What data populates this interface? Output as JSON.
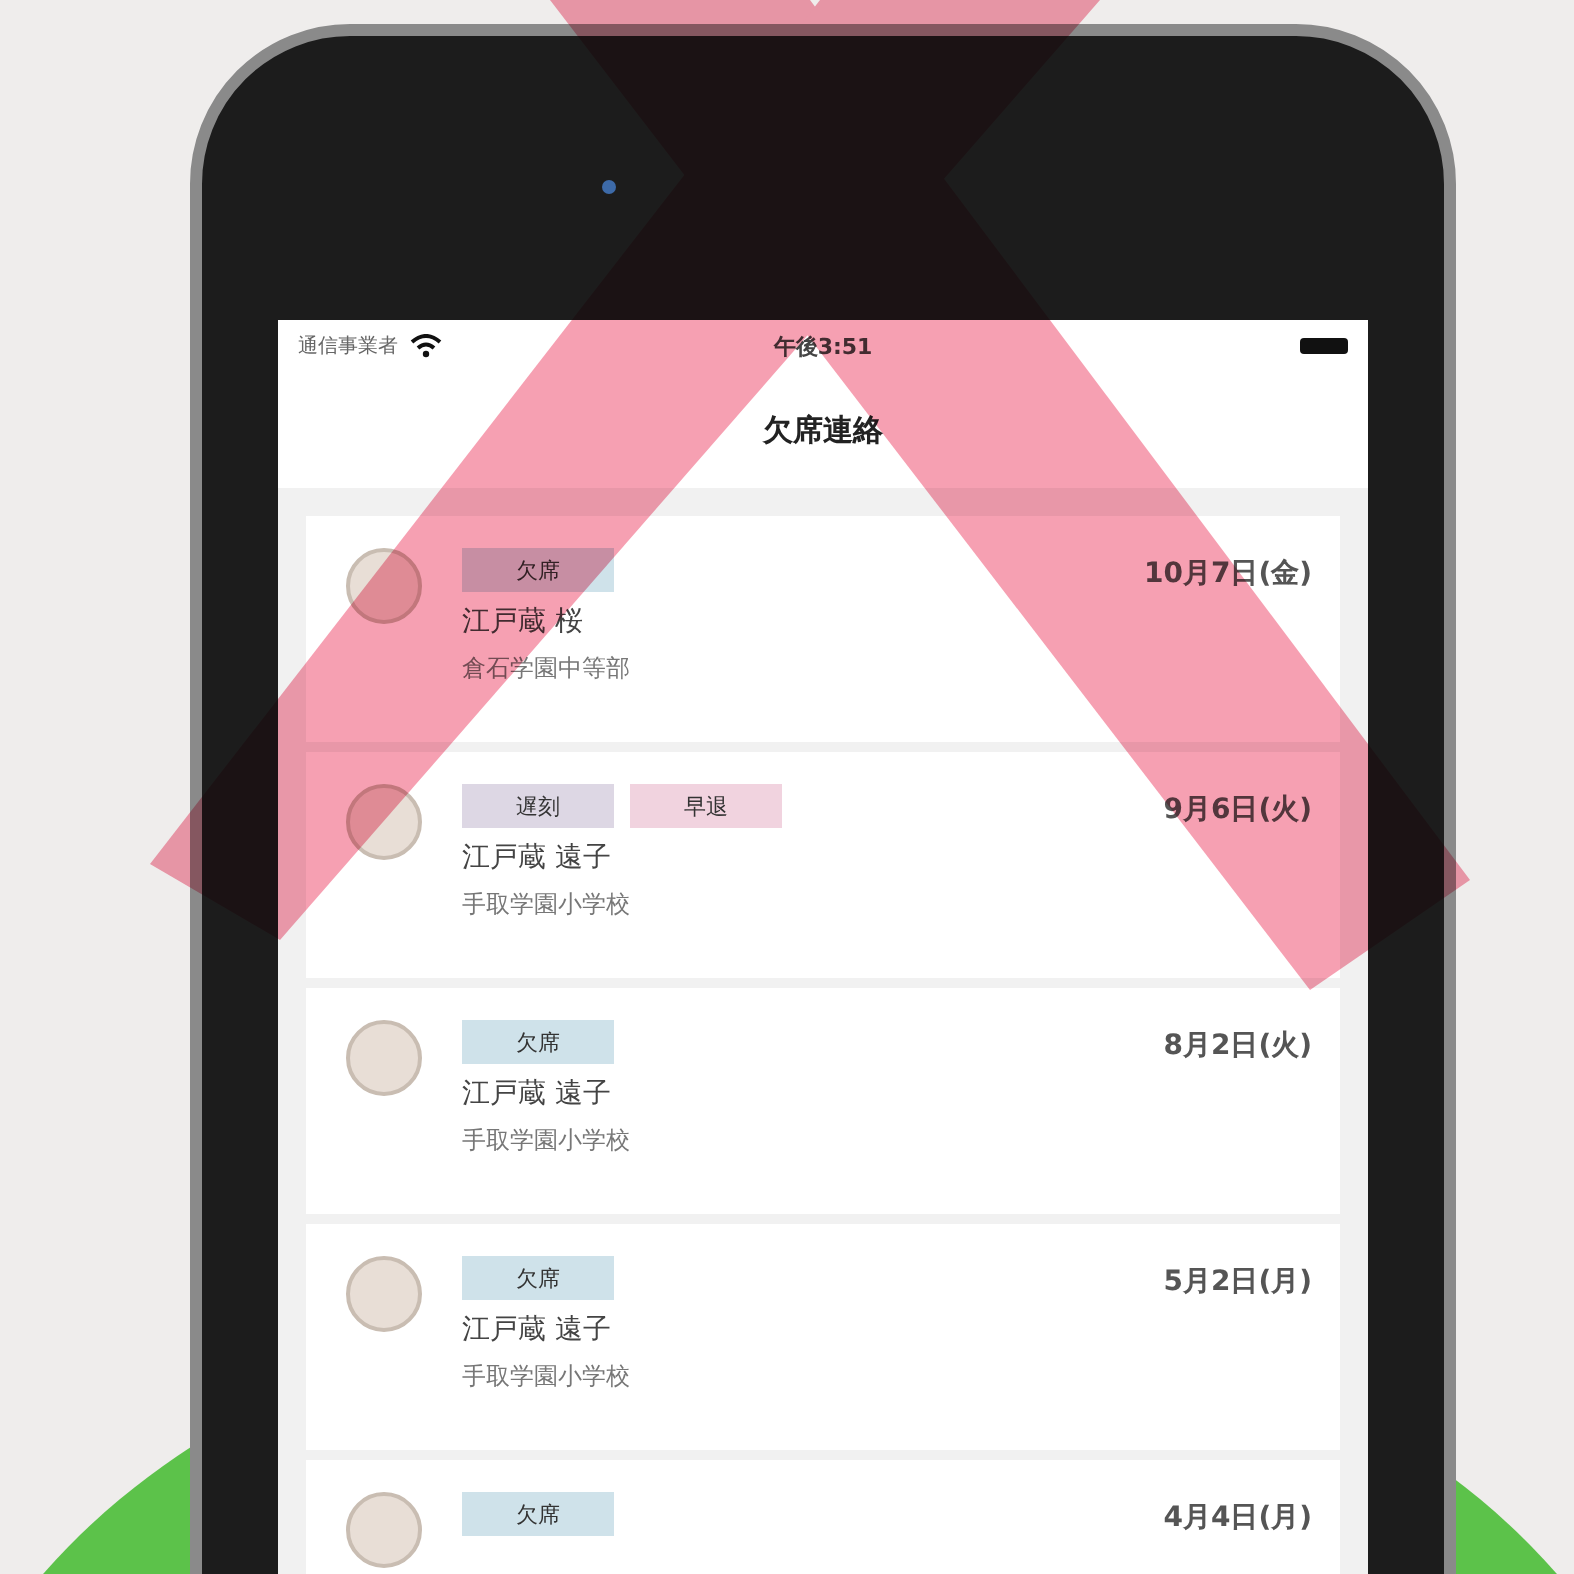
{
  "status_bar": {
    "carrier": "通信事業者",
    "time": "午後3:51"
  },
  "nav": {
    "title": "欠席連絡"
  },
  "items": [
    {
      "tags": [
        {
          "label": "欠席",
          "color": "#cfe2ea"
        }
      ],
      "name": "江戸蔵 桜",
      "school": "倉石学園中等部",
      "date": "10月7日(金)"
    },
    {
      "tags": [
        {
          "label": "遅刻",
          "color": "#ddd7e4"
        },
        {
          "label": "早退",
          "color": "#f1d3df"
        }
      ],
      "name": "江戸蔵 遠子",
      "school": "手取学園小学校",
      "date": "9月6日(火)"
    },
    {
      "tags": [
        {
          "label": "欠席",
          "color": "#cfe2ea"
        }
      ],
      "name": "江戸蔵 遠子",
      "school": "手取学園小学校",
      "date": "8月2日(火)"
    },
    {
      "tags": [
        {
          "label": "欠席",
          "color": "#cfe2ea"
        }
      ],
      "name": "江戸蔵 遠子",
      "school": "手取学園小学校",
      "date": "5月2日(月)"
    },
    {
      "tags": [
        {
          "label": "欠席",
          "color": "#cfe2ea"
        }
      ],
      "date": "4月4日(月)"
    }
  ]
}
